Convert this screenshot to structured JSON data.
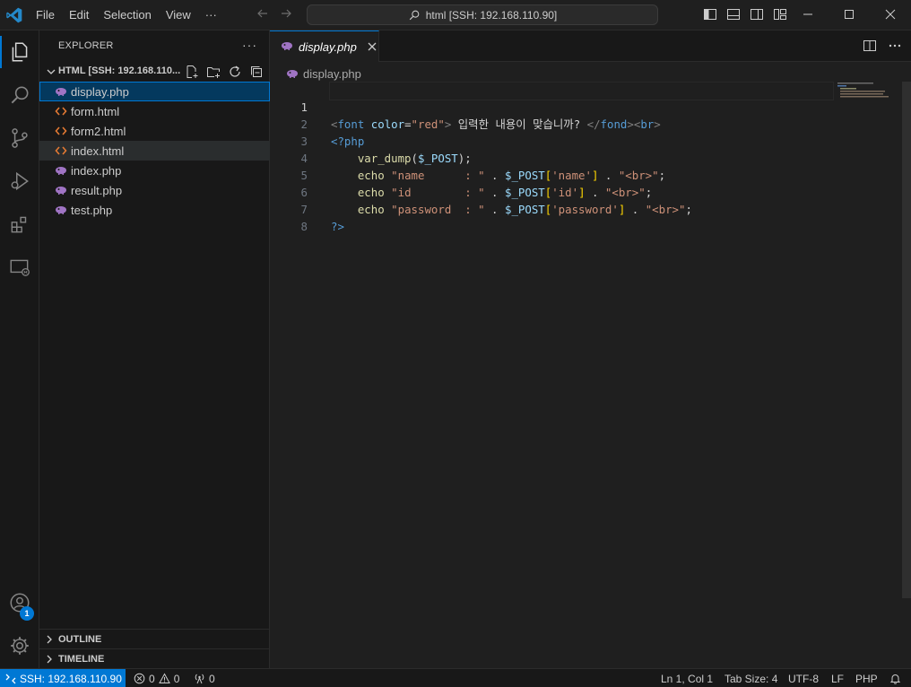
{
  "titlebar": {
    "menu": [
      "File",
      "Edit",
      "Selection",
      "View",
      "···"
    ],
    "command_center": "html [SSH: 192.168.110.90]"
  },
  "activity": {
    "account_badge": "1"
  },
  "sidebar": {
    "title": "EXPLORER",
    "more": "···",
    "folder": "HTML [SSH: 192.168.110...",
    "files": [
      {
        "name": "display.php",
        "type": "php"
      },
      {
        "name": "form.html",
        "type": "html"
      },
      {
        "name": "form2.html",
        "type": "html"
      },
      {
        "name": "index.html",
        "type": "html"
      },
      {
        "name": "index.php",
        "type": "php"
      },
      {
        "name": "result.php",
        "type": "php"
      },
      {
        "name": "test.php",
        "type": "php"
      }
    ],
    "sections": [
      "OUTLINE",
      "TIMELINE"
    ]
  },
  "editor": {
    "tab_label": "display.php",
    "breadcrumb": "display.php",
    "line_numbers": [
      "1",
      "2",
      "3",
      "4",
      "5",
      "6",
      "7",
      "8"
    ],
    "code": {
      "l1": {
        "a": "<",
        "b": "font",
        "c": " color",
        "d": "=",
        "e": "\"red\"",
        "f": ">",
        "g": " 입력한 내용이 맞습니까? ",
        "h": "</",
        "i": "fond",
        "j": ">",
        "k": "<",
        "l": "br",
        "m": ">"
      },
      "l2": {
        "a": "<?php"
      },
      "l3": {
        "a": "    ",
        "b": "var_dump",
        "c": "(",
        "d": "$_POST",
        "e": ");"
      },
      "l4": {
        "a": "    ",
        "b": "echo",
        "c": " ",
        "d": "\"name      : \"",
        "e": " . ",
        "f": "$_POST",
        "g": "[",
        "h": "'name'",
        "i": "]",
        "j": " . ",
        "k": "\"<br>\"",
        "l": ";"
      },
      "l5": {
        "a": "    ",
        "b": "echo",
        "c": " ",
        "d": "\"id        : \"",
        "e": " . ",
        "f": "$_POST",
        "g": "[",
        "h": "'id'",
        "i": "]",
        "j": " . ",
        "k": "\"<br>\"",
        "l": ";"
      },
      "l6": {
        "a": "    ",
        "b": "echo",
        "c": " ",
        "d": "\"password  : \"",
        "e": " . ",
        "f": "$_POST",
        "g": "[",
        "h": "'password'",
        "i": "]",
        "j": " . ",
        "k": "\"<br>\"",
        "l": ";"
      },
      "l7": {
        "a": "?>"
      }
    }
  },
  "statusbar": {
    "remote": "SSH: 192.168.110.90",
    "errors": "0",
    "warnings": "0",
    "ports": "0",
    "position": "Ln 1, Col 1",
    "tab_size": "Tab Size: 4",
    "encoding": "UTF-8",
    "eol": "LF",
    "language": "PHP"
  },
  "colors": {
    "accent": "#0078d4",
    "php_icon": "#a074c4",
    "html_icon": "#e37933"
  }
}
